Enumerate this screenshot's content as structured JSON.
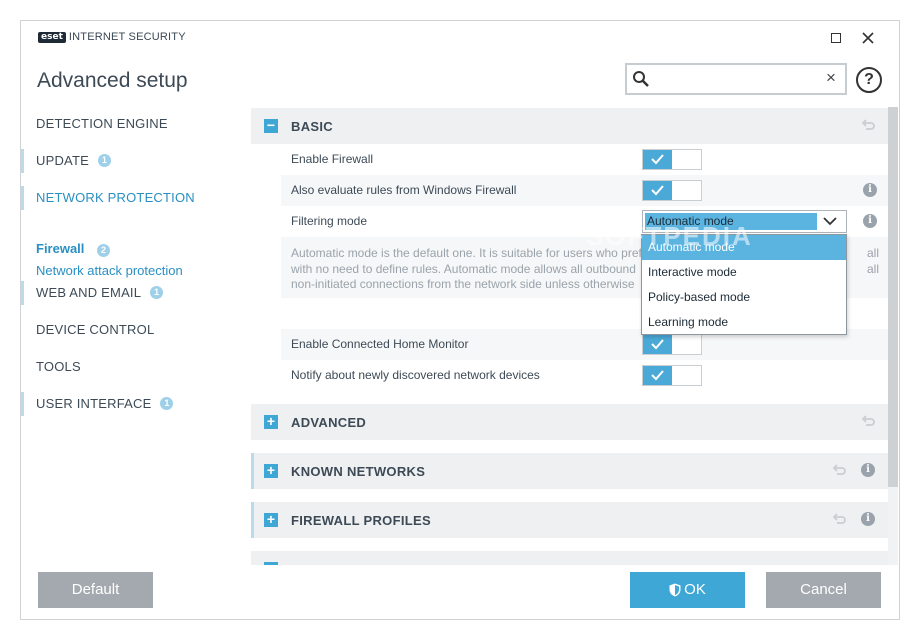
{
  "app": {
    "logo_badge": "eset",
    "logo_text": "INTERNET SECURITY",
    "title": "Advanced setup"
  },
  "search": {
    "placeholder": "",
    "value": "",
    "clear": "×"
  },
  "help_icon": "?",
  "sidebar": {
    "items": [
      {
        "label": "DETECTION ENGINE",
        "badge": ""
      },
      {
        "label": "UPDATE",
        "badge": "1"
      },
      {
        "label": "NETWORK PROTECTION",
        "badge": ""
      },
      {
        "label": "WEB AND EMAIL",
        "badge": "1"
      },
      {
        "label": "DEVICE CONTROL",
        "badge": ""
      },
      {
        "label": "TOOLS",
        "badge": ""
      },
      {
        "label": "USER INTERFACE",
        "badge": "1"
      }
    ],
    "sub_items": [
      {
        "label": "Firewall",
        "badge": "2"
      },
      {
        "label": "Network attack protection"
      }
    ]
  },
  "sections": {
    "basic": {
      "title": "BASIC",
      "toggle": "−"
    },
    "advanced": {
      "title": "ADVANCED",
      "toggle": "+"
    },
    "known_networks": {
      "title": "KNOWN NETWORKS",
      "toggle": "+"
    },
    "firewall_profiles": {
      "title": "FIREWALL PROFILES",
      "toggle": "+"
    }
  },
  "settings": {
    "enable_firewall": "Enable Firewall",
    "evaluate_windows": "Also evaluate rules from Windows Firewall",
    "filtering_mode": "Filtering mode",
    "filtering_mode_value": "Automatic mode",
    "description_lines": [
      "Automatic mode is the default one. It is suitable for users who prefer",
      "with no need to define rules. Automatic mode allows all outbound",
      "non-initiated connections from the network side unless otherwise"
    ],
    "description_tail": [
      "all",
      "all"
    ],
    "connected_home": "Enable Connected Home Monitor",
    "notify_devices": "Notify about newly discovered network devices"
  },
  "dropdown": {
    "options": [
      "Automatic mode",
      "Interactive mode",
      "Policy-based mode",
      "Learning mode"
    ],
    "selected": "Automatic mode"
  },
  "info_icon": "i",
  "watermark": "SOFTPEDIA",
  "footer": {
    "default_label": "Default",
    "ok_label": "OK",
    "cancel_label": "Cancel"
  },
  "colors": {
    "accent": "#3fa7d6",
    "gray_button": "#a3a9ae",
    "selection": "#5bb3e0",
    "text": "#3d4a56",
    "link": "#2a8fc2"
  }
}
